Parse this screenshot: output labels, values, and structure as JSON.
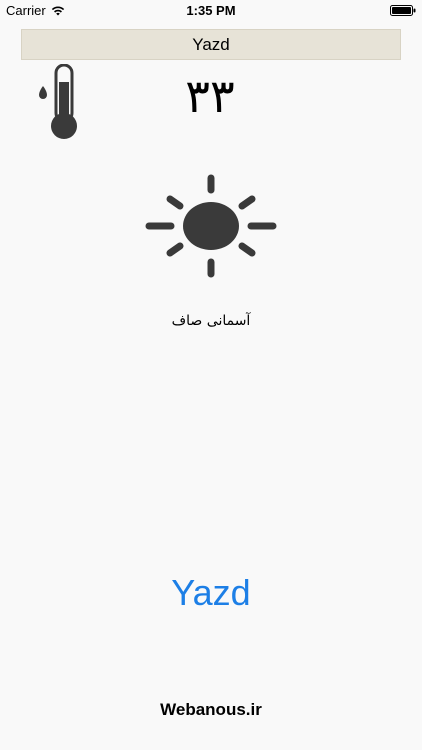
{
  "status_bar": {
    "carrier": "Carrier",
    "time": "1:35 PM",
    "wifi_icon": "wifi-icon",
    "battery_icon": "battery-icon"
  },
  "header": {
    "title": "Yazd"
  },
  "weather": {
    "temperature": "۳۳",
    "thermometer_icon": "thermometer-icon",
    "condition_icon": "sun-icon",
    "condition": "آسمانی صاف"
  },
  "city_link": "Yazd",
  "footer": {
    "brand": "Webanous.ir"
  },
  "colors": {
    "background": "#f9f9f9",
    "title_bar": "#e7e3d7",
    "icon_fill": "#3a3a3a",
    "link": "#1d7fe6"
  }
}
